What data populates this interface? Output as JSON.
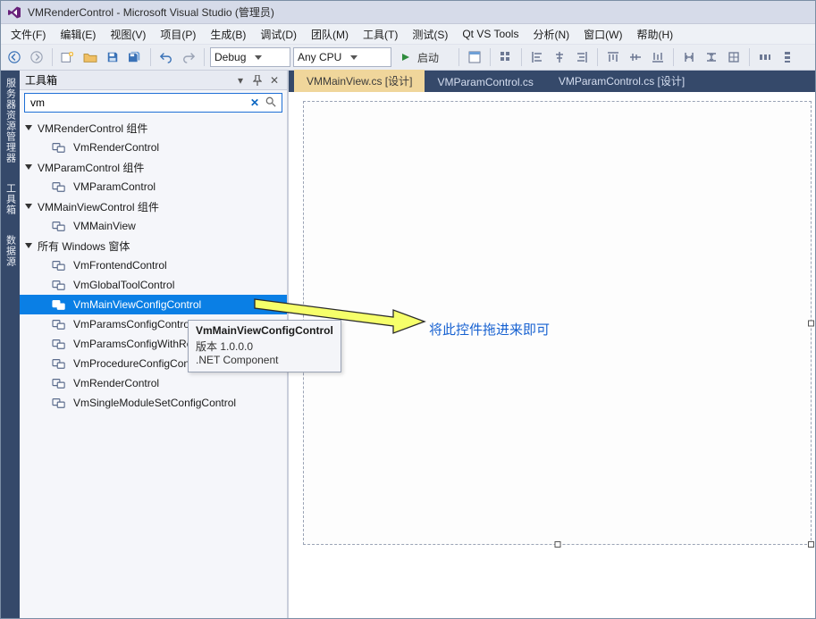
{
  "window": {
    "title": "VMRenderControl - Microsoft Visual Studio (管理员)"
  },
  "menu": {
    "items": [
      "文件(F)",
      "编辑(E)",
      "视图(V)",
      "项目(P)",
      "生成(B)",
      "调试(D)",
      "团队(M)",
      "工具(T)",
      "测试(S)",
      "Qt VS Tools",
      "分析(N)",
      "窗口(W)",
      "帮助(H)"
    ]
  },
  "toolbar": {
    "config": "Debug",
    "platform": "Any CPU",
    "start": "启动"
  },
  "sidetabs": {
    "a": "服务器资源管理器",
    "b": "工具箱",
    "c": "数据源"
  },
  "toolbox": {
    "title": "工具箱",
    "search_value": "vm",
    "clear_icon": "✕",
    "search_icon": "🔍",
    "groups": [
      {
        "label": "VMRenderControl 组件",
        "items": [
          "VmRenderControl"
        ]
      },
      {
        "label": "VMParamControl 组件",
        "items": [
          "VMParamControl"
        ]
      },
      {
        "label": "VMMainViewControl 组件",
        "items": [
          "VMMainView"
        ]
      },
      {
        "label": "所有 Windows 窗体",
        "items": [
          "VmFrontendControl",
          "VmGlobalToolControl",
          "VmMainViewConfigControl",
          "VmParamsConfigControl",
          "VmParamsConfigWithRenderControl",
          "VmProcedureConfigControl",
          "VmRenderControl",
          "VmSingleModuleSetConfigControl"
        ]
      }
    ],
    "selected_index": {
      "g": 3,
      "i": 2
    }
  },
  "tooltip": {
    "title": "VmMainViewConfigControl",
    "version": "版本 1.0.0.0",
    "kind": ".NET Component"
  },
  "documents": {
    "tabs": [
      {
        "label": "VMMainView.cs [设计]",
        "active": true
      },
      {
        "label": "VMParamControl.cs",
        "active": false
      },
      {
        "label": "VMParamControl.cs [设计]",
        "active": false
      }
    ]
  },
  "callout": {
    "text": "将此控件拖进来即可"
  }
}
